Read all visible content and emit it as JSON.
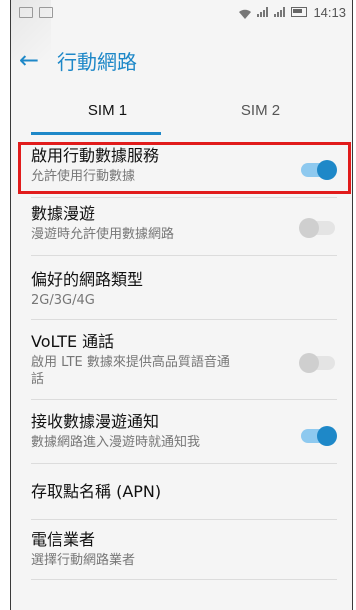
{
  "status_bar": {
    "time": "14:13",
    "sim_labels": [
      "1",
      "2"
    ]
  },
  "header": {
    "title": "行動網路"
  },
  "tabs": [
    {
      "label": "SIM 1",
      "active": true
    },
    {
      "label": "SIM 2",
      "active": false
    }
  ],
  "settings": [
    {
      "title": "啟用行動數據服務",
      "subtitle": "允許使用行動數據",
      "toggle": "on"
    },
    {
      "title": "數據漫遊",
      "subtitle": "漫遊時允許使用數據網路",
      "toggle": "off"
    },
    {
      "title": "偏好的網路類型",
      "subtitle": "2G/3G/4G",
      "toggle": null
    },
    {
      "title": "VoLTE 通話",
      "subtitle": "啟用 LTE 數據來提供高品質語音通話",
      "toggle": "off"
    },
    {
      "title": "接收數據漫遊通知",
      "subtitle": "數據網路進入漫遊時就通知我",
      "toggle": "on"
    },
    {
      "title": "存取點名稱 (APN)",
      "subtitle": "",
      "toggle": null
    },
    {
      "title": "電信業者",
      "subtitle": "選擇行動網路業者",
      "toggle": null
    }
  ],
  "colors": {
    "accent": "#1e88c8",
    "highlight": "#e11b1b"
  }
}
